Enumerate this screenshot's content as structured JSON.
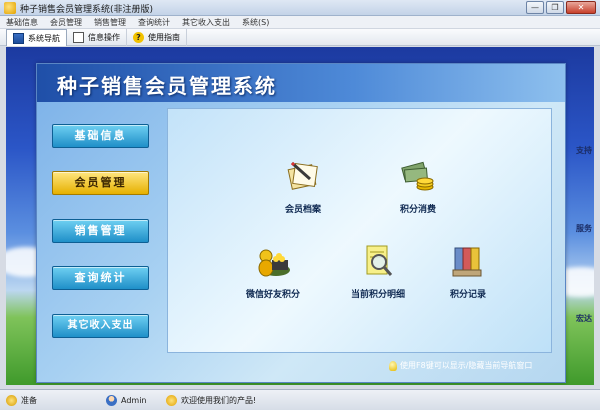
{
  "window": {
    "title": "种子销售会员管理系统(非注册版)",
    "minimize_glyph": "—",
    "restore_glyph": "❐",
    "close_glyph": "✕"
  },
  "menu": [
    "基础信息",
    "会员管理",
    "销售管理",
    "查询统计",
    "其它收入支出",
    "系统(S)"
  ],
  "toolbar": {
    "items": [
      {
        "label": "系统导航",
        "icon": "nav-icon"
      },
      {
        "label": "信息操作",
        "icon": "document-icon"
      },
      {
        "label": "使用指南",
        "icon": "help-icon"
      }
    ],
    "help_glyph": "?"
  },
  "panel": {
    "title": "种子销售会员管理系统"
  },
  "nav_buttons": [
    {
      "label": "基础信息",
      "active": false
    },
    {
      "label": "会员管理",
      "active": true
    },
    {
      "label": "销售管理",
      "active": false
    },
    {
      "label": "查询统计",
      "active": false
    },
    {
      "label": "其它收入支出",
      "active": false
    }
  ],
  "features": [
    {
      "label": "会员档案",
      "icon": "member-file-icon"
    },
    {
      "label": "积分消费",
      "icon": "points-consume-icon"
    },
    {
      "label": "微信好友积分",
      "icon": "wechat-points-icon"
    },
    {
      "label": "当前积分明细",
      "icon": "points-detail-icon"
    },
    {
      "label": "积分记录",
      "icon": "points-record-icon"
    }
  ],
  "hint": "使用F8键可以显示/隐藏当前导航窗口",
  "background_side_text": [
    "支持",
    "服务",
    "宏达"
  ],
  "status": {
    "ready": "准备",
    "user": "Admin",
    "message": "欢迎使用我们的产品!"
  },
  "colors": {
    "nav_button": "#1f8fc8",
    "nav_button_active": "#e6b000",
    "header": "#1f4fa8"
  }
}
